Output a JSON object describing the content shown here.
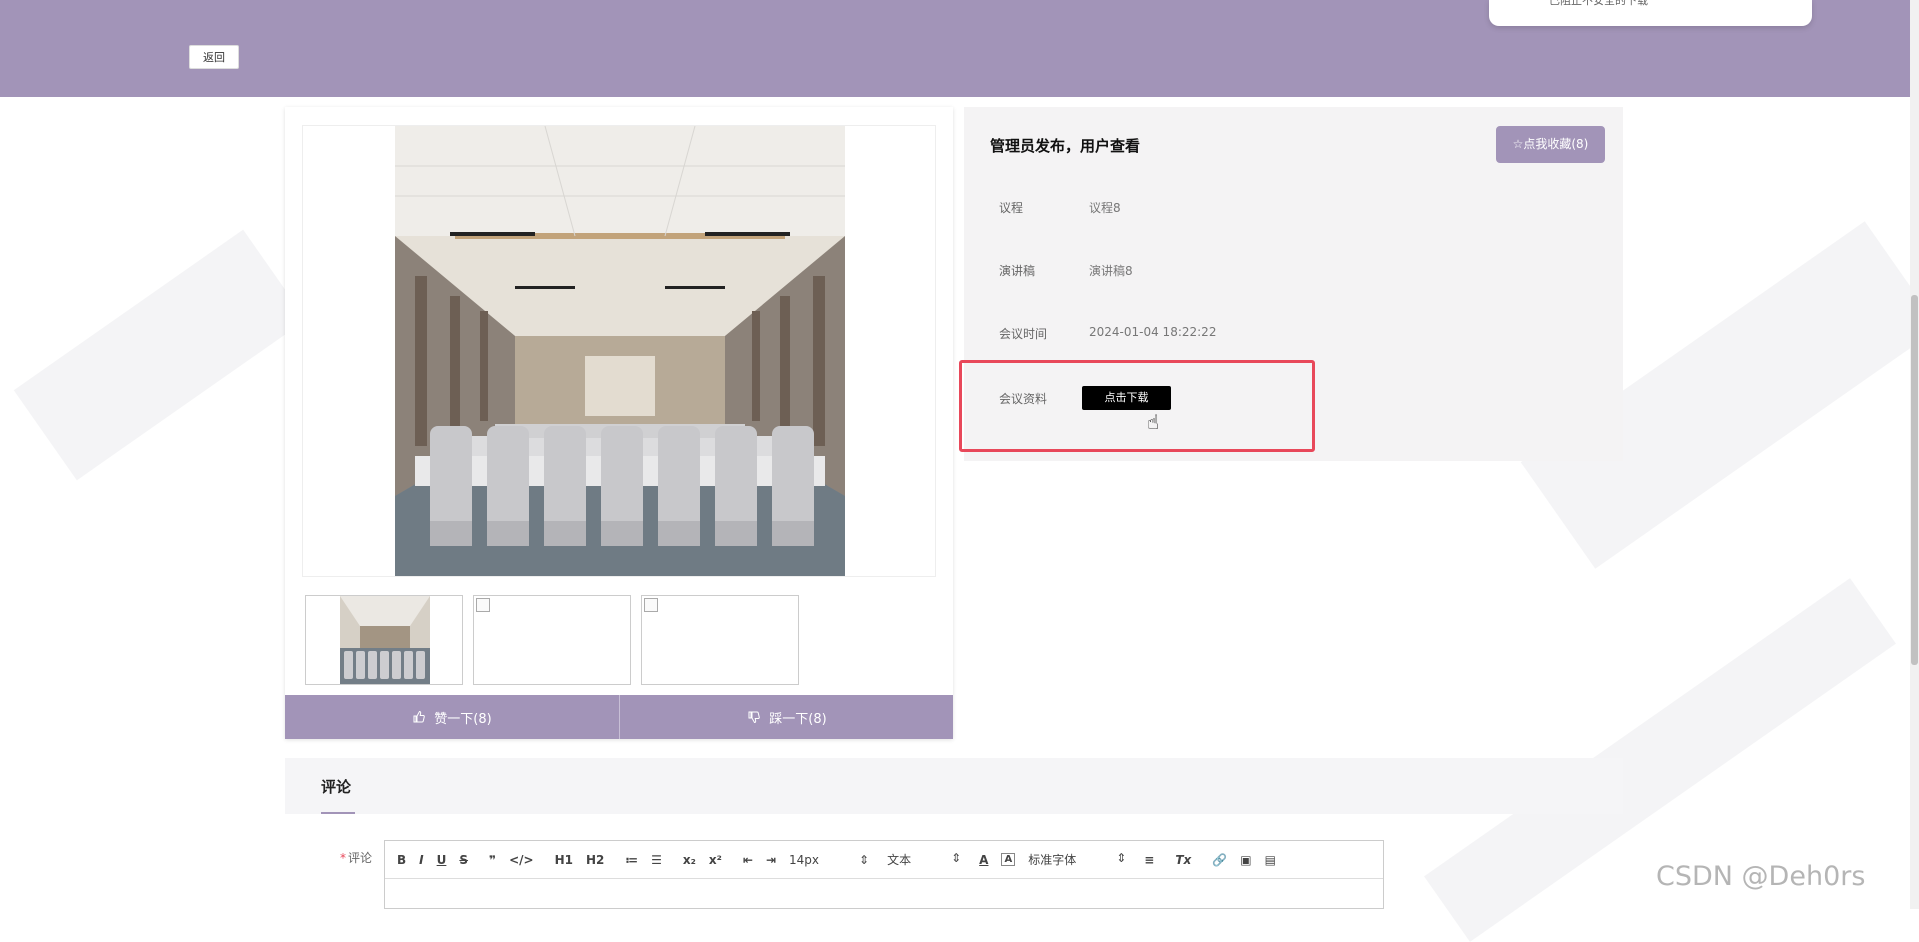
{
  "header": {
    "back_label": "返回",
    "notice_text": "已阻止不安全的下载"
  },
  "gallery": {
    "vote_up_label": "赞一下(8)",
    "vote_down_label": "踩一下(8)"
  },
  "detail": {
    "title": "管理员发布，用户查看",
    "favorite_label": "☆点我收藏(8)",
    "rows": [
      {
        "label": "议程",
        "value": "议程8"
      },
      {
        "label": "演讲稿",
        "value": "演讲稿8"
      },
      {
        "label": "会议时间",
        "value": "2024-01-04 18:22:22"
      },
      {
        "label": "会议资料",
        "value": ""
      }
    ],
    "download_label": "点击下载"
  },
  "comment": {
    "section_title": "评论",
    "field_label": "评论",
    "required_mark": "*",
    "toolbar": {
      "bold": "B",
      "italic": "I",
      "underline": "U",
      "strike": "S",
      "quote": "❞",
      "code": "</>",
      "h1": "H1",
      "h2": "H2",
      "ordered_list": "≔",
      "bullet_list": "☰",
      "subscript": "x₂",
      "superscript": "x²",
      "outdent": "⇤",
      "indent": "⇥",
      "size": "14px",
      "text_style": "文本",
      "font_color": "A",
      "background_color": "A",
      "font_family": "标准字体",
      "align": "≡",
      "clear_format": "Tx",
      "link": "🔗",
      "image": "▣",
      "video": "▤"
    }
  },
  "watermark": "CSDN @Deh0rs",
  "colors": {
    "accent": "#a294b8",
    "highlight": "#e8485a"
  }
}
